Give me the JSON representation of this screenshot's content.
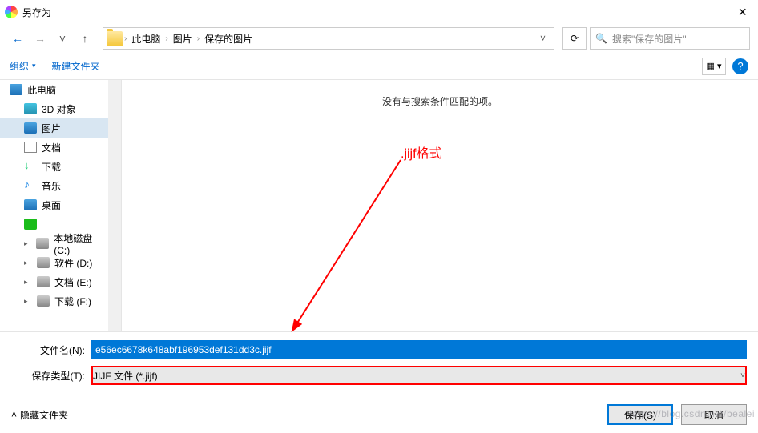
{
  "window": {
    "title": "另存为"
  },
  "nav": {
    "path": [
      "此电脑",
      "图片",
      "保存的图片"
    ]
  },
  "search": {
    "placeholder": "搜索\"保存的图片\""
  },
  "toolbar": {
    "organize": "组织",
    "new_folder": "新建文件夹"
  },
  "tree": {
    "root": "此电脑",
    "items": [
      {
        "label": "3D 对象",
        "icon": "cube"
      },
      {
        "label": "图片",
        "icon": "pic",
        "selected": true
      },
      {
        "label": "文档",
        "icon": "doc"
      },
      {
        "label": "下载",
        "icon": "down"
      },
      {
        "label": "音乐",
        "icon": "music"
      },
      {
        "label": "桌面",
        "icon": "desk"
      },
      {
        "label": "",
        "icon": "green"
      },
      {
        "label": "本地磁盘 (C:)",
        "icon": "disk"
      },
      {
        "label": "软件 (D:)",
        "icon": "disk"
      },
      {
        "label": "文档 (E:)",
        "icon": "disk"
      },
      {
        "label": "下载 (F:)",
        "icon": "disk"
      }
    ]
  },
  "content": {
    "empty": "没有与搜索条件匹配的项。"
  },
  "annotation": {
    "text": ".jijf格式"
  },
  "fields": {
    "filename_label": "文件名(N):",
    "filename_value": "e56ec6678k648abf196953def131dd3c.jijf",
    "type_label": "保存类型(T):",
    "type_value": "JIJF 文件 (*.jijf)"
  },
  "footer": {
    "hide": "隐藏文件夹",
    "save": "保存(S)",
    "cancel": "取消"
  }
}
